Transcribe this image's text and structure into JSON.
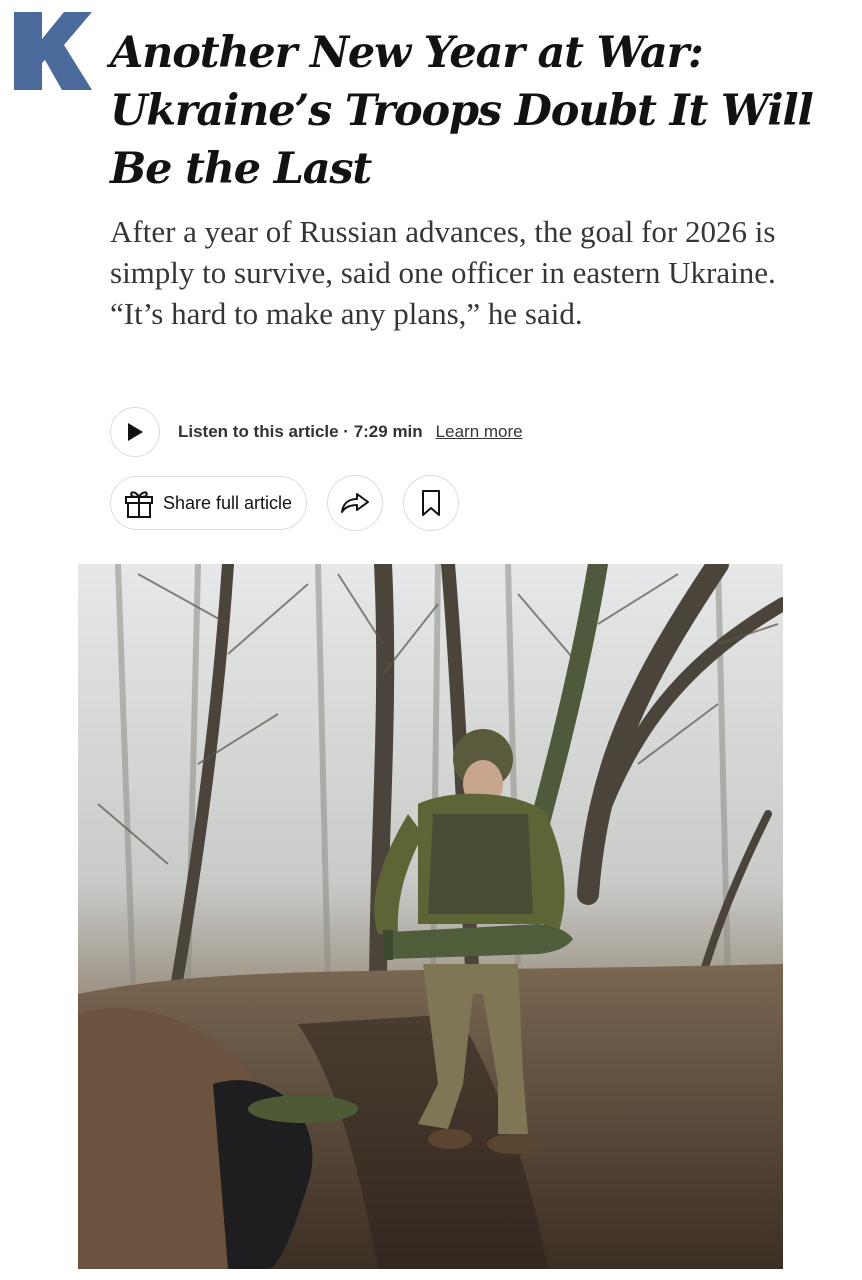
{
  "article": {
    "headline": "Another New Year at War: Ukraine’s Troops Doubt It Will Be the Last",
    "summary": "After a year of Russian advances, the goal for 2026 is simply to survive, said one officer in eastern Ukraine. “It’s hard to make any plans,” he said."
  },
  "audio": {
    "play_icon": "play-icon",
    "listen_label": "Listen to this article · 7:29 min",
    "learn_more": "Learn more"
  },
  "share": {
    "gift_icon": "gift-icon",
    "share_full_label": "Share full article",
    "share_icon": "share-arrow-icon",
    "bookmark_icon": "bookmark-icon"
  },
  "logo": {
    "letter": "K",
    "color": "#4a6a9c"
  },
  "colors": {
    "text": "#121212",
    "dek": "#363636",
    "button_border": "#dcdcdc"
  }
}
